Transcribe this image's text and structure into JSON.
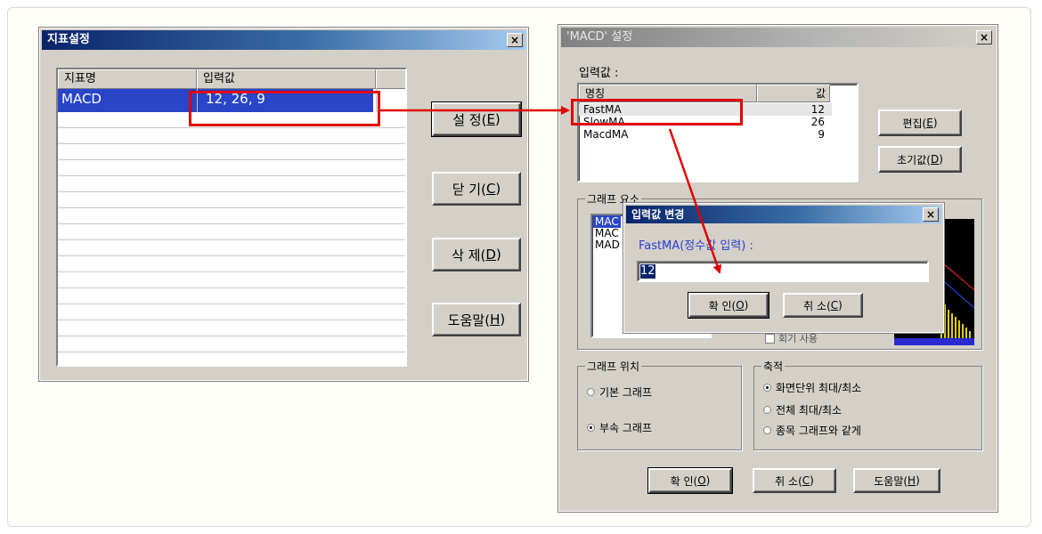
{
  "left_dialog": {
    "title": "지표설정",
    "close": "×",
    "columns": [
      "지표명",
      "입력값"
    ],
    "row": {
      "name": "MACD",
      "value": "12, 26, 9"
    },
    "buttons": {
      "set": {
        "text": "설 정(",
        "key": "E",
        "end": ")"
      },
      "close": {
        "text": "닫 기(",
        "key": "C",
        "end": ")"
      },
      "delete": {
        "text": "삭 제(",
        "key": "D",
        "end": ")"
      },
      "help": {
        "text": "도움말(",
        "key": "H",
        "end": ")"
      }
    }
  },
  "right_dialog": {
    "title": "'MACD' 설정",
    "close": "×",
    "input_label": "입력값 :",
    "columns": [
      "명칭",
      "값"
    ],
    "params": [
      {
        "name": "FastMA",
        "value": "12"
      },
      {
        "name": "SlowMA",
        "value": "26"
      },
      {
        "name": "MacdMA",
        "value": "9"
      }
    ],
    "edit_button": {
      "text": "편집(",
      "key": "E",
      "end": ")"
    },
    "reset_button": {
      "text": "초기값(",
      "key": "D",
      "end": ")"
    },
    "graph_group_label": "그래프 요소",
    "graph_items": [
      "MAC",
      "MAC",
      "MAD"
    ],
    "partial_checkbox_label": "회기 사용",
    "position_group": {
      "label": "그래프 위치",
      "options": [
        "기본 그래프",
        "부속 그래프"
      ],
      "selected": 1
    },
    "scale_group": {
      "label": "축적",
      "options": [
        "화면단위 최대/최소",
        "전체 최대/최소",
        "종목 그래프와 같게"
      ],
      "selected": 0
    },
    "ok": {
      "text": "확 인(",
      "key": "O",
      "end": ")"
    },
    "cancel": {
      "text": "취 소(",
      "key": "C",
      "end": ")"
    },
    "help": {
      "text": "도움말(",
      "key": "H",
      "end": ")"
    }
  },
  "popup": {
    "title": "입력값 변경",
    "close": "×",
    "prompt": "FastMA(정수값 입력) :",
    "value": "12",
    "ok": {
      "text": "확 인(",
      "key": "O",
      "end": ")"
    },
    "cancel": {
      "text": "취 소(",
      "key": "C",
      "end": ")"
    }
  },
  "colors": {
    "highlight": "#2a45c8",
    "annotation": "#e00000",
    "prompt_text": "#2a3fd0"
  }
}
